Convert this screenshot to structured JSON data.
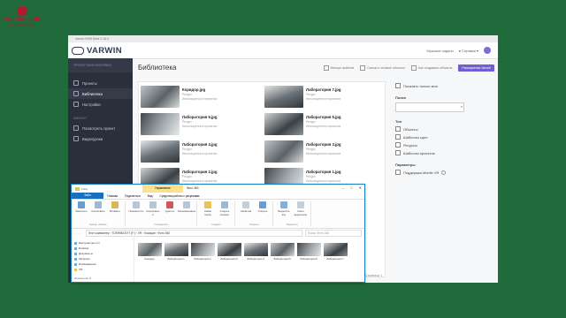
{
  "logo": {
    "line1": "МИНИНСКИЙ",
    "line2": "УНИВЕРСИТЕТ"
  },
  "window": {
    "title": "Varwin RMS Beta 0.16.0"
  },
  "brand": {
    "name": "VARWIN"
  },
  "topbar": {
    "user_label": "Мужские задачи",
    "help_label": "Справка"
  },
  "sidebar": {
    "header": "ПРОЕКТ МУЛЬТИСЕРВИС",
    "items": [
      {
        "label": "Проекты",
        "icon": "folder-icon"
      },
      {
        "label": "Библиотека",
        "icon": "library-icon",
        "active": true
      },
      {
        "label": "Настройки",
        "icon": "gear-icon"
      }
    ],
    "section_label": "АККАУНТ",
    "items2": [
      {
        "label": "Посмотреть проект",
        "icon": "eye-icon"
      },
      {
        "label": "Видеоуроки",
        "icon": "video-icon"
      }
    ]
  },
  "main": {
    "title": "Библиотека",
    "toolbar": {
      "import": "Импорт файлов",
      "download": "Скачать готовые объекты",
      "create": "Как создавать объекты",
      "extensions": "Расширения Varwin"
    },
    "cards": [
      {
        "name": "Коридор.jpg",
        "type": "Ресурс",
        "used": "Используется в проектах"
      },
      {
        "name": "Лаборатория 7.jpg",
        "type": "Ресурс",
        "used": "Используется в проектах"
      },
      {
        "name": "Лаборатория 6.jpg",
        "type": "Ресурс",
        "used": "Используется в проектах"
      },
      {
        "name": "Лаборатория 5.jpg",
        "type": "Ресурс",
        "used": "Используется в проектах"
      },
      {
        "name": "Лаборатория 4.jpg",
        "type": "Ресурс",
        "used": "Используется в проектах"
      },
      {
        "name": "Лаборатория 3.jpg",
        "type": "Ресурс",
        "used": "Используется в проектах"
      },
      {
        "name": "Лаборатория 2.jpg",
        "type": "Ресурс",
        "used": "Используется в проектах"
      },
      {
        "name": "Лаборатория 1.jpg",
        "type": "Ресурс",
        "used": "Используется в проектах"
      }
    ],
    "filters": {
      "show_only_mine": "Показать только мои",
      "search_label": "Поиск",
      "type_label": "Тип",
      "types": [
        "Объекты",
        "Шаблоны сцен",
        "Ресурсы",
        "Шаблоны проектов"
      ],
      "params_label": "Параметры",
      "params": [
        "Поддержка Mobile VR"
      ]
    },
    "pager": "Страница 1"
  },
  "explorer": {
    "context_tab": "Управление",
    "folder_name": "Фото 360",
    "tabs": [
      "Файл",
      "Главная",
      "Поделиться",
      "Вид",
      "Средства работы с рисунками"
    ],
    "ribbon": [
      {
        "label": "Буфер обмена",
        "buttons": [
          "Закрепить",
          "Копировать",
          "Вставить"
        ]
      },
      {
        "label": "Упорядочить",
        "buttons": [
          "Переместить",
          "Копировать в",
          "Удалить",
          "Переименовать"
        ]
      },
      {
        "label": "Создать",
        "buttons": [
          "Новая папка",
          "Создать элемент"
        ]
      },
      {
        "label": "Открыть",
        "buttons": [
          "Свойства",
          "Открыть"
        ]
      },
      {
        "label": "Выделить",
        "buttons": [
          "Выделить все",
          "Снять выделение"
        ]
      }
    ],
    "path": "Этот компьютер › TOSHIBA EXT (F:) › VR › Локации › Фото 360",
    "search_placeholder": "Поиск: Фото 360",
    "nav": [
      "Быстрый доступ",
      "Desktop",
      "Документы",
      "Загрузки",
      "Изображения",
      "VR"
    ],
    "files": [
      "Коридор",
      "Лаборатория 1",
      "Лаборатория 2",
      "Лаборатория 3",
      "Лаборатория 4",
      "Лаборатория 5",
      "Лаборатория 6",
      "Лаборатория 7"
    ],
    "status": "Элементов: 8"
  }
}
